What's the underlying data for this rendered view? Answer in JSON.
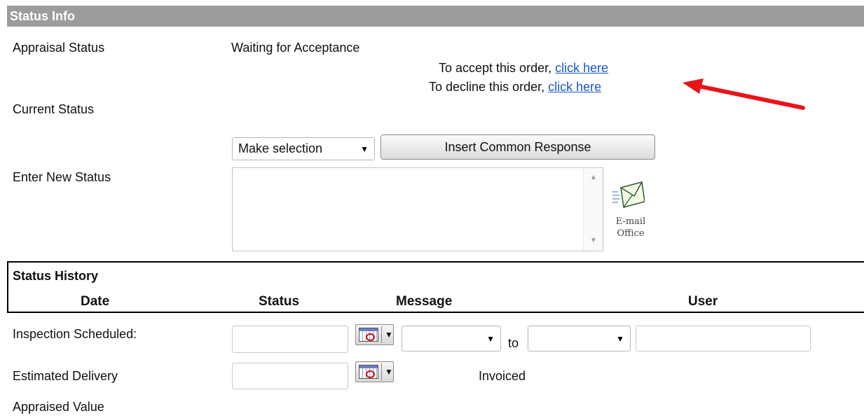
{
  "header": {
    "title": "Status Info"
  },
  "appraisal_status": {
    "label": "Appraisal Status",
    "value": "Waiting for Acceptance"
  },
  "accept_line": {
    "text": "To accept this order,",
    "link": "click here"
  },
  "decline_line": {
    "text": "To decline this order,",
    "link": "click here"
  },
  "current_status": {
    "label": "Current Status"
  },
  "response": {
    "select_value": "Make selection",
    "button": "Insert Common Response"
  },
  "new_status": {
    "label": "Enter New Status",
    "value": ""
  },
  "email_office": {
    "line1": "E-mail",
    "line2": "Office"
  },
  "history": {
    "title": "Status History",
    "columns": [
      "Date",
      "Status",
      "Message",
      "User"
    ]
  },
  "inspection": {
    "label": "Inspection Scheduled:",
    "to_label": "to"
  },
  "delivery": {
    "label": "Estimated Delivery",
    "invoiced": "Invoiced"
  },
  "appraised_value": {
    "label": "Appraised Value"
  },
  "colors": {
    "header_bg": "#9c9c9c",
    "link": "#1a56c8",
    "arrow": "#e8141a"
  }
}
